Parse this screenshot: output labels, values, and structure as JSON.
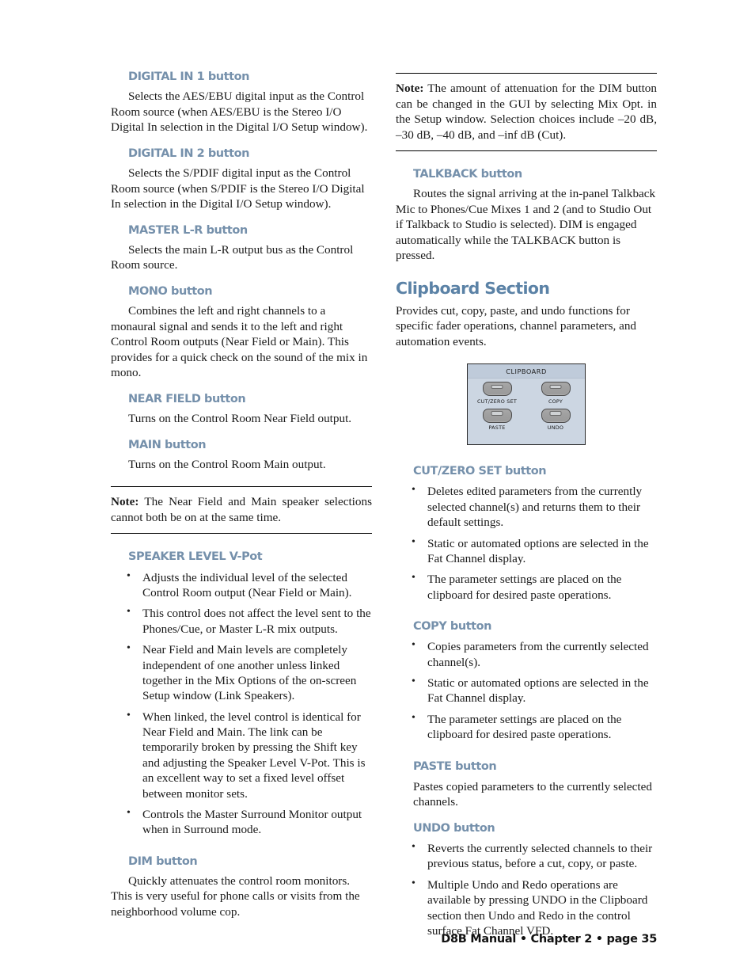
{
  "page": {
    "footer": "D8B Manual • Chapter 2 • page 35"
  },
  "theme": {
    "heading_color": "#7590ab",
    "section_heading_color": "#5b82a6",
    "body_color": "#1a1a1a",
    "panel_bg": "#ccd6e2",
    "panel_header_bg": "#bfcbda",
    "button_face": "#a0a0a0"
  },
  "left_column": {
    "blocks": [
      {
        "type": "heading",
        "text": "DIGITAL IN 1 button"
      },
      {
        "type": "paragraph",
        "text": "Selects the AES/EBU digital input as the Control Room source (when AES/EBU is the Stereo I/O Digital In selection in the Digital I/O Setup window)."
      },
      {
        "type": "heading",
        "text": "DIGITAL IN 2 button"
      },
      {
        "type": "paragraph",
        "text": "Selects the S/PDIF digital input as the Control Room source (when S/PDIF is the Stereo I/O Digital In selection in the Digital I/O Setup window)."
      },
      {
        "type": "heading",
        "text": "MASTER L-R button"
      },
      {
        "type": "paragraph",
        "text": "Selects the main L-R output bus as the Control Room source."
      },
      {
        "type": "heading",
        "text": "MONO button"
      },
      {
        "type": "paragraph",
        "text": "Combines the left and right channels to a monaural signal and sends it to the left and right Control Room outputs (Near Field or Main). This provides for a quick check on the sound of the mix in mono."
      },
      {
        "type": "heading",
        "text": "NEAR FIELD button"
      },
      {
        "type": "paragraph",
        "text": "Turns on the Control Room Near Field output."
      },
      {
        "type": "heading",
        "text": "MAIN button"
      },
      {
        "type": "paragraph",
        "text": "Turns on the Control Room Main output."
      },
      {
        "type": "note",
        "label": "Note:",
        "text": " The Near Field and Main speaker selections cannot both be on at the same time."
      },
      {
        "type": "heading",
        "text": "SPEAKER LEVEL V-Pot"
      },
      {
        "type": "bullets",
        "items": [
          "Adjusts the individual level of the selected Control Room output (Near Field or Main).",
          "This control does not affect the level sent to the Phones/Cue, or Master L-R mix outputs.",
          "Near Field and Main levels are completely independent of one another unless linked together in the Mix Options of the on-screen Setup window (Link Speakers).",
          "When linked, the level control is identical for Near Field and Main. The link can be temporarily broken by pressing the Shift key and adjusting the Speaker Level V-Pot.  This is an excellent way to set a fixed level offset between monitor sets.",
          "Controls the Master Surround Monitor output when in Surround mode."
        ]
      },
      {
        "type": "heading",
        "text": "DIM button"
      },
      {
        "type": "paragraph",
        "text": "Quickly attenuates the control room monitors. This is very useful for phone calls or visits from the neighborhood volume cop."
      }
    ]
  },
  "right_column": {
    "blocks": [
      {
        "type": "note",
        "label": "Note:",
        "text": " The amount of attenuation for the DIM button can be changed in the GUI by selecting Mix Opt. in the Setup window. Selection choices include –20 dB, –30 dB, –40 dB, and –inf dB (Cut)."
      },
      {
        "type": "heading",
        "text": "TALKBACK button"
      },
      {
        "type": "paragraph",
        "text": "Routes the signal arriving at the in-panel Talkback Mic to Phones/Cue Mixes 1 and 2 (and to Studio Out if Talkback to Studio is selected). DIM is engaged automatically while the TALKBACK button is pressed."
      },
      {
        "type": "section_heading",
        "text": "Clipboard Section"
      },
      {
        "type": "intro",
        "text": "Provides cut, copy, paste, and undo functions for specific fader operations, channel parameters, and automation events."
      },
      {
        "type": "figure",
        "figure": "clipboard_panel"
      },
      {
        "type": "heading",
        "text": "CUT/ZERO SET button"
      },
      {
        "type": "bullets",
        "items": [
          "Deletes edited parameters from the currently selected channel(s) and returns them to their default settings.",
          "Static or automated options are selected in the Fat Channel display.",
          "The parameter settings are placed on the clipboard for desired paste operations."
        ]
      },
      {
        "type": "heading",
        "text": "COPY button"
      },
      {
        "type": "bullets",
        "items": [
          "Copies parameters from the currently selected channel(s).",
          "Static or automated options are selected in the Fat Channel display.",
          "The parameter settings are placed on the clipboard for desired paste operations."
        ]
      },
      {
        "type": "heading",
        "text": "PASTE button"
      },
      {
        "type": "paragraph_indented",
        "text": "Pastes copied parameters to the currently selected channels."
      },
      {
        "type": "heading",
        "text": "UNDO button"
      },
      {
        "type": "bullets",
        "items": [
          "Reverts the currently selected channels to their previous status, before a cut, copy, or paste.",
          "Multiple Undo and Redo operations are available by pressing UNDO in the Clipboard section then Undo and Redo in the control surface Fat Channel VFD."
        ]
      }
    ]
  },
  "clipboard_figure": {
    "title": "CLIPBOARD",
    "buttons": [
      {
        "label": "CUT/ZERO SET"
      },
      {
        "label": "COPY"
      },
      {
        "label": "PASTE"
      },
      {
        "label": "UNDO"
      }
    ]
  }
}
